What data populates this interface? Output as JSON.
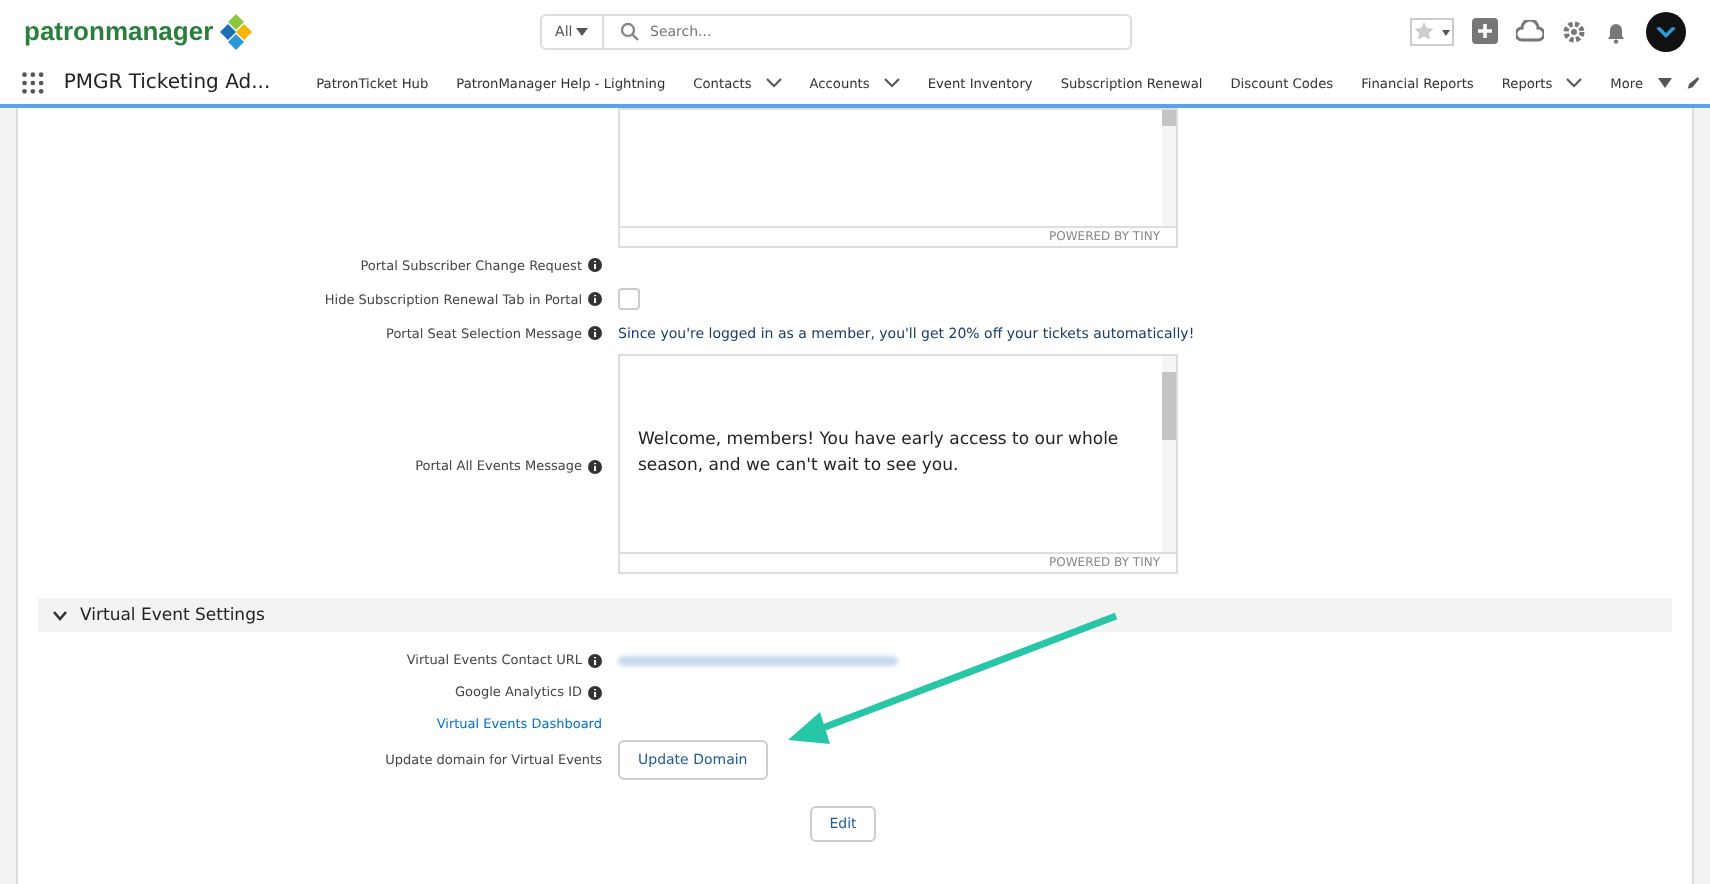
{
  "header": {
    "logo": "patronmanager",
    "search_scope": "All",
    "search_placeholder": "Search..."
  },
  "nav": {
    "app_name": "PMGR Ticketing Ad...",
    "items": [
      {
        "label": "PatronTicket Hub",
        "dropdown": false
      },
      {
        "label": "PatronManager Help - Lightning",
        "dropdown": false
      },
      {
        "label": "Contacts",
        "dropdown": true
      },
      {
        "label": "Accounts",
        "dropdown": true
      },
      {
        "label": "Event Inventory",
        "dropdown": false
      },
      {
        "label": "Subscription Renewal",
        "dropdown": false
      },
      {
        "label": "Discount Codes",
        "dropdown": false
      },
      {
        "label": "Financial Reports",
        "dropdown": false
      },
      {
        "label": "Reports",
        "dropdown": true
      }
    ],
    "more": "More"
  },
  "top_editor": {
    "footer": "POWERED BY TINY"
  },
  "fields": [
    {
      "kind": "empty",
      "label": "Portal Subscriber Change Request"
    },
    {
      "kind": "checkbox",
      "label": "Hide Subscription Renewal Tab in Portal",
      "checked": false
    },
    {
      "kind": "text",
      "label": "Portal Seat Selection Message",
      "value": "Since you're logged in as a member, you'll get 20% off your tickets automatically!"
    },
    {
      "kind": "editor",
      "label": "Portal All Events Message",
      "value": "Welcome, members! You have early access to our whole season, and we can't wait to see you.",
      "footer": "POWERED BY TINY"
    }
  ],
  "section": {
    "title": "Virtual Event Settings",
    "expanded": true,
    "fields": [
      {
        "kind": "redacted",
        "label": "Virtual Events Contact URL"
      },
      {
        "kind": "empty",
        "label": "Google Analytics ID"
      },
      {
        "kind": "link",
        "label": "Virtual Events Dashboard"
      },
      {
        "kind": "button",
        "label": "Update domain for Virtual Events",
        "button": "Update Domain"
      }
    ]
  },
  "edit_button": "Edit"
}
